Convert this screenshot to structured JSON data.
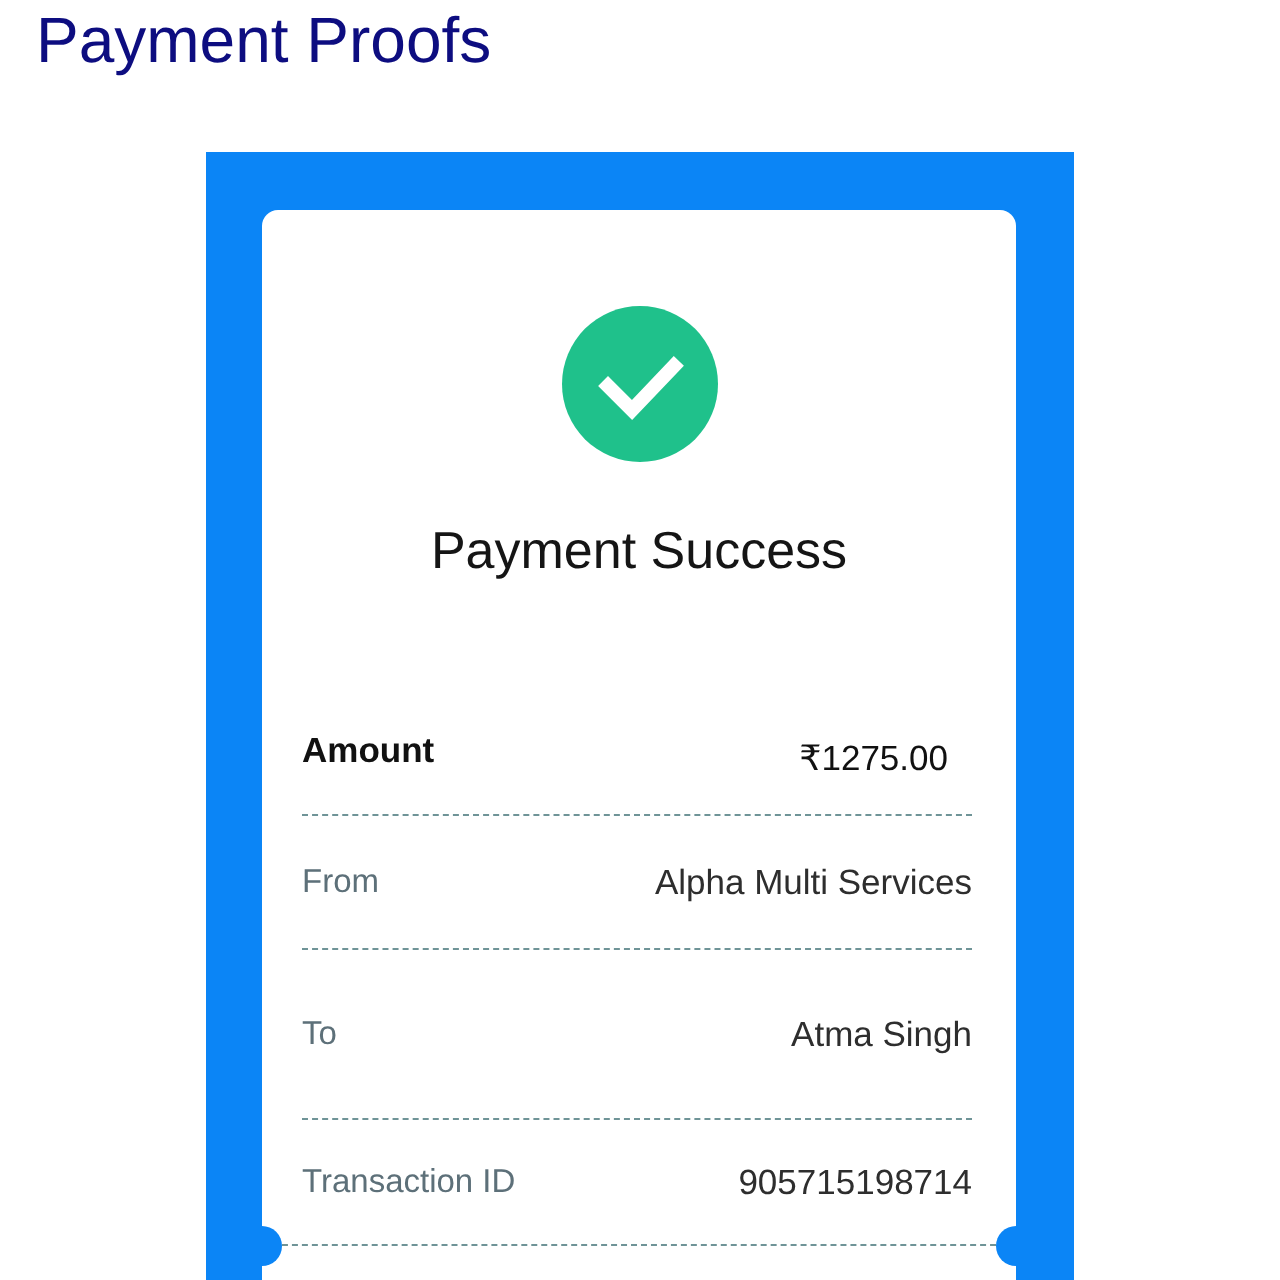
{
  "page": {
    "title": "Payment Proofs"
  },
  "receipt": {
    "succeeded": true,
    "heading": "Payment Success",
    "rows": [
      {
        "kind": "amount",
        "label": "Amount",
        "value": "₹1275.00"
      },
      {
        "kind": "detail",
        "label": "From",
        "value": "Alpha Multi Services"
      },
      {
        "kind": "detail",
        "label": "To",
        "value": "Atma Singh"
      },
      {
        "kind": "detail",
        "label": "Transaction ID",
        "value": "905715198714"
      }
    ]
  }
}
